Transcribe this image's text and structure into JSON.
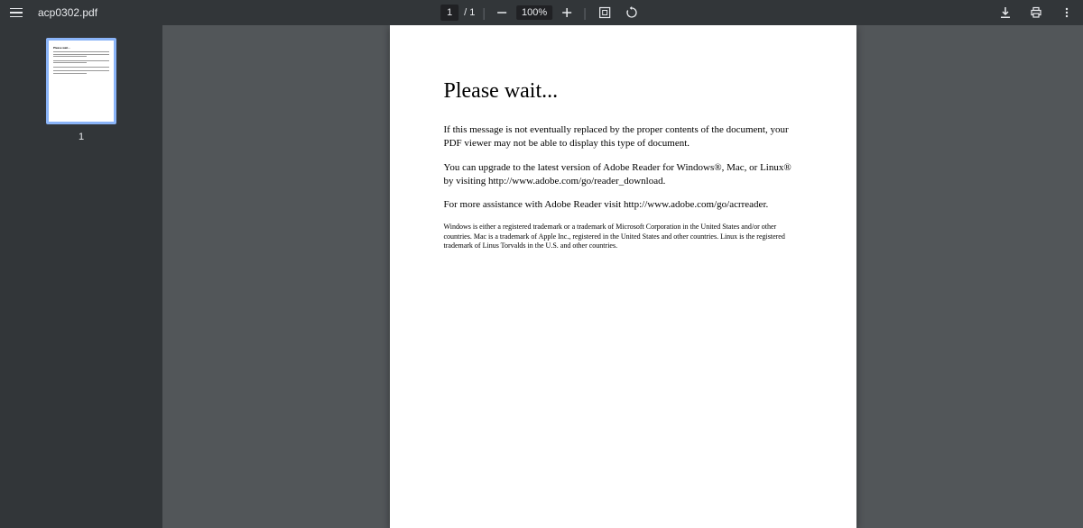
{
  "toolbar": {
    "filename": "acp0302.pdf",
    "current_page": "1",
    "total_pages": "/ 1",
    "zoom_level": "100%"
  },
  "sidebar": {
    "thumbnail_page_number": "1"
  },
  "document": {
    "heading": "Please wait...",
    "para1": "If this message is not eventually replaced by the proper contents of the document, your PDF viewer may not be able to display this type of document.",
    "para2": "You can upgrade to the latest version of Adobe Reader for Windows®, Mac, or Linux® by visiting  http://www.adobe.com/go/reader_download.",
    "para3": "For more assistance with Adobe Reader visit  http://www.adobe.com/go/acrreader.",
    "footnote": "Windows is either a registered trademark or a trademark of Microsoft Corporation in the United States and/or other countries. Mac is a trademark of Apple Inc., registered in the United States and other countries. Linux is the registered trademark of Linus Torvalds in the U.S. and other countries."
  }
}
